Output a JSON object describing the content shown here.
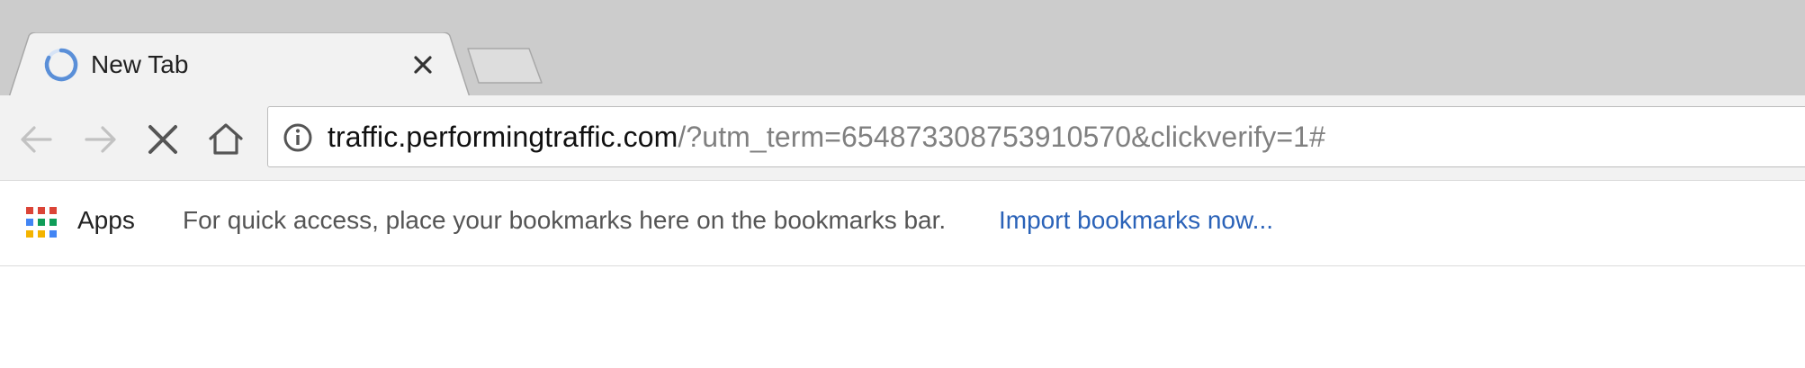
{
  "tab": {
    "title": "New Tab",
    "loading_icon": "spinner-icon",
    "close_icon": "close-icon"
  },
  "toolbar": {
    "back_icon": "arrow-left-icon",
    "forward_icon": "arrow-right-icon",
    "stop_icon": "close-icon",
    "home_icon": "home-icon"
  },
  "omnibox": {
    "info_icon": "info-icon",
    "url_host": "traffic.performingtraffic.com",
    "url_path": "/?utm_term=654873308753910570&clickverify=1#"
  },
  "bookmarks_bar": {
    "apps_label": "Apps",
    "apps_icon": "apps-grid-icon",
    "hint": "For quick access, place your bookmarks here on the bookmarks bar.",
    "import_link": "Import bookmarks now..."
  },
  "colors": {
    "tabstrip": "#cccccc",
    "toolbar": "#f2f2f2",
    "spinner": "#5a8fd8",
    "link": "#2a62b8"
  }
}
